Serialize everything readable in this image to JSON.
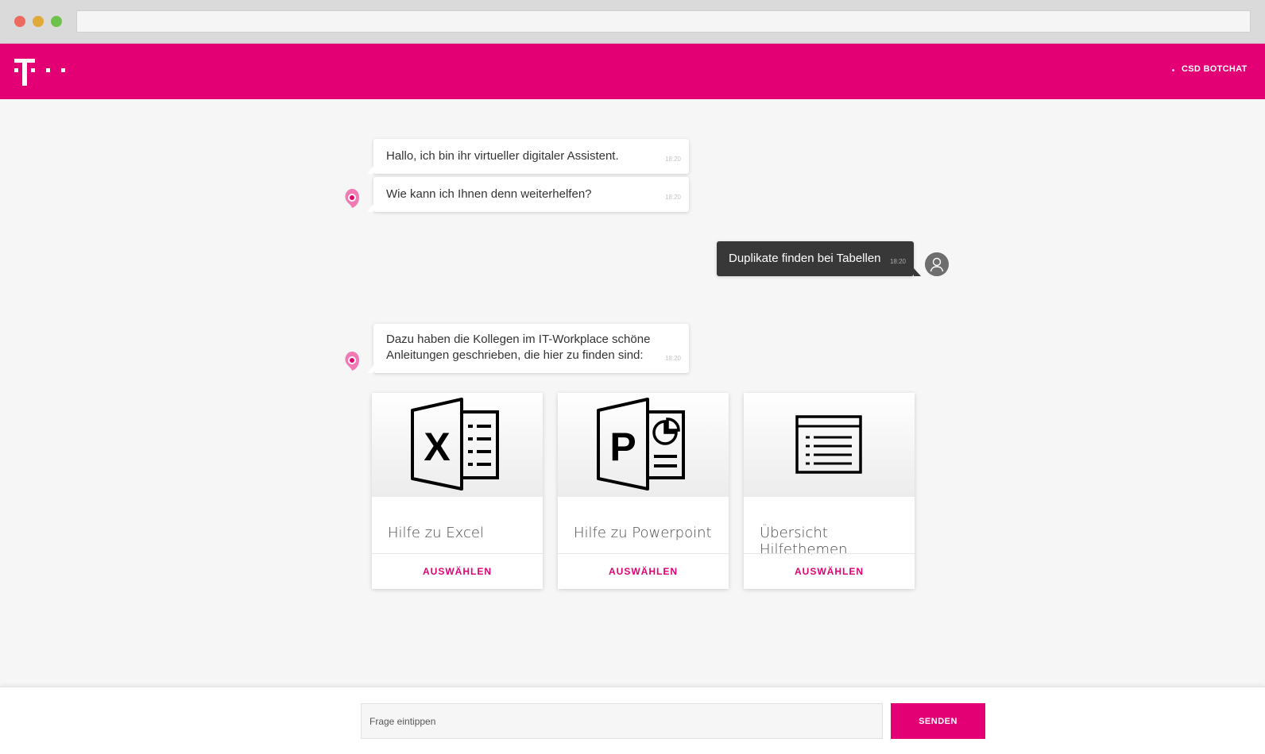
{
  "header": {
    "brand": "T",
    "nav_title": "CSD BOTCHAT",
    "accent_color": "#e20074"
  },
  "messages": [
    {
      "sender": "bot",
      "text": "Hallo, ich bin ihr virtueller digitaler Assistent.",
      "time": "18:20"
    },
    {
      "sender": "bot",
      "text": "Wie kann ich Ihnen denn weiterhelfen?",
      "time": "18:20"
    },
    {
      "sender": "user",
      "text": "Duplikate finden bei Tabellen",
      "time": "18:20"
    },
    {
      "sender": "bot",
      "text_line1": "Dazu haben die Kollegen im IT-Workplace schöne",
      "text_line2": "Anleitungen geschrieben, die hier zu finden sind:",
      "time": "18:20"
    }
  ],
  "cards": [
    {
      "icon": "excel-icon",
      "title": "Hilfe zu Excel",
      "action": "AUSWÄHLEN"
    },
    {
      "icon": "powerpoint-icon",
      "title": "Hilfe zu Powerpoint",
      "action": "AUSWÄHLEN"
    },
    {
      "icon": "list-window-icon",
      "title": "Übersicht Hilfethemen",
      "action": "AUSWÄHLEN"
    }
  ],
  "composer": {
    "placeholder": "Frage eintippen",
    "value": "",
    "send_label": "SENDEN"
  }
}
